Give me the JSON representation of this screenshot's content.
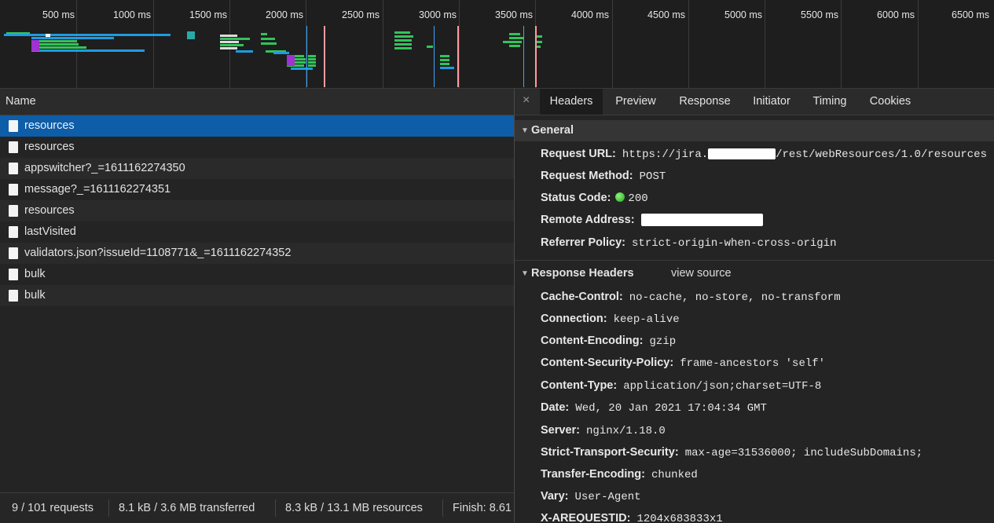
{
  "timeline": {
    "ticks": [
      "500 ms",
      "1000 ms",
      "1500 ms",
      "2000 ms",
      "2500 ms",
      "3000 ms",
      "3500 ms",
      "4000 ms",
      "4500 ms",
      "5000 ms",
      "5500 ms",
      "6000 ms",
      "6500 ms"
    ]
  },
  "requests": {
    "column_header": "Name",
    "rows": [
      {
        "name": "resources"
      },
      {
        "name": "resources"
      },
      {
        "name": "appswitcher?_=1611162274350"
      },
      {
        "name": "message?_=1611162274351"
      },
      {
        "name": "resources"
      },
      {
        "name": "lastVisited"
      },
      {
        "name": "validators.json?issueId=1108771&_=1611162274352"
      },
      {
        "name": "bulk"
      },
      {
        "name": "bulk"
      }
    ],
    "selected_index": 0
  },
  "status_bar": {
    "requests": "9 / 101 requests",
    "transferred": "8.1 kB / 3.6 MB transferred",
    "resources": "8.3 kB / 13.1 MB resources",
    "finish": "Finish: 8.61"
  },
  "detail_tabs": {
    "close_symbol": "×",
    "tabs": [
      "Headers",
      "Preview",
      "Response",
      "Initiator",
      "Timing",
      "Cookies"
    ],
    "active": "Headers"
  },
  "general": {
    "title": "General",
    "request_url_key": "Request URL:",
    "request_url_prefix": "https://jira.",
    "request_url_suffix": "/rest/webResources/1.0/resources",
    "request_method_key": "Request Method:",
    "request_method": "POST",
    "status_code_key": "Status Code:",
    "status_code": "200",
    "status_color": "#2db82d",
    "remote_address_key": "Remote Address:",
    "referrer_policy_key": "Referrer Policy:",
    "referrer_policy": "strict-origin-when-cross-origin"
  },
  "response_headers": {
    "title": "Response Headers",
    "view_source": "view source",
    "items": [
      {
        "key": "Cache-Control:",
        "value": "no-cache, no-store, no-transform"
      },
      {
        "key": "Connection:",
        "value": "keep-alive"
      },
      {
        "key": "Content-Encoding:",
        "value": "gzip"
      },
      {
        "key": "Content-Security-Policy:",
        "value": "frame-ancestors 'self'"
      },
      {
        "key": "Content-Type:",
        "value": "application/json;charset=UTF-8"
      },
      {
        "key": "Date:",
        "value": "Wed, 20 Jan 2021 17:04:34 GMT"
      },
      {
        "key": "Server:",
        "value": "nginx/1.18.0"
      },
      {
        "key": "Strict-Transport-Security:",
        "value": "max-age=31536000; includeSubDomains;"
      },
      {
        "key": "Transfer-Encoding:",
        "value": "chunked"
      },
      {
        "key": "Vary:",
        "value": "User-Agent"
      },
      {
        "key": "X-AREQUESTID:",
        "value": "1204x683833x1"
      }
    ]
  }
}
